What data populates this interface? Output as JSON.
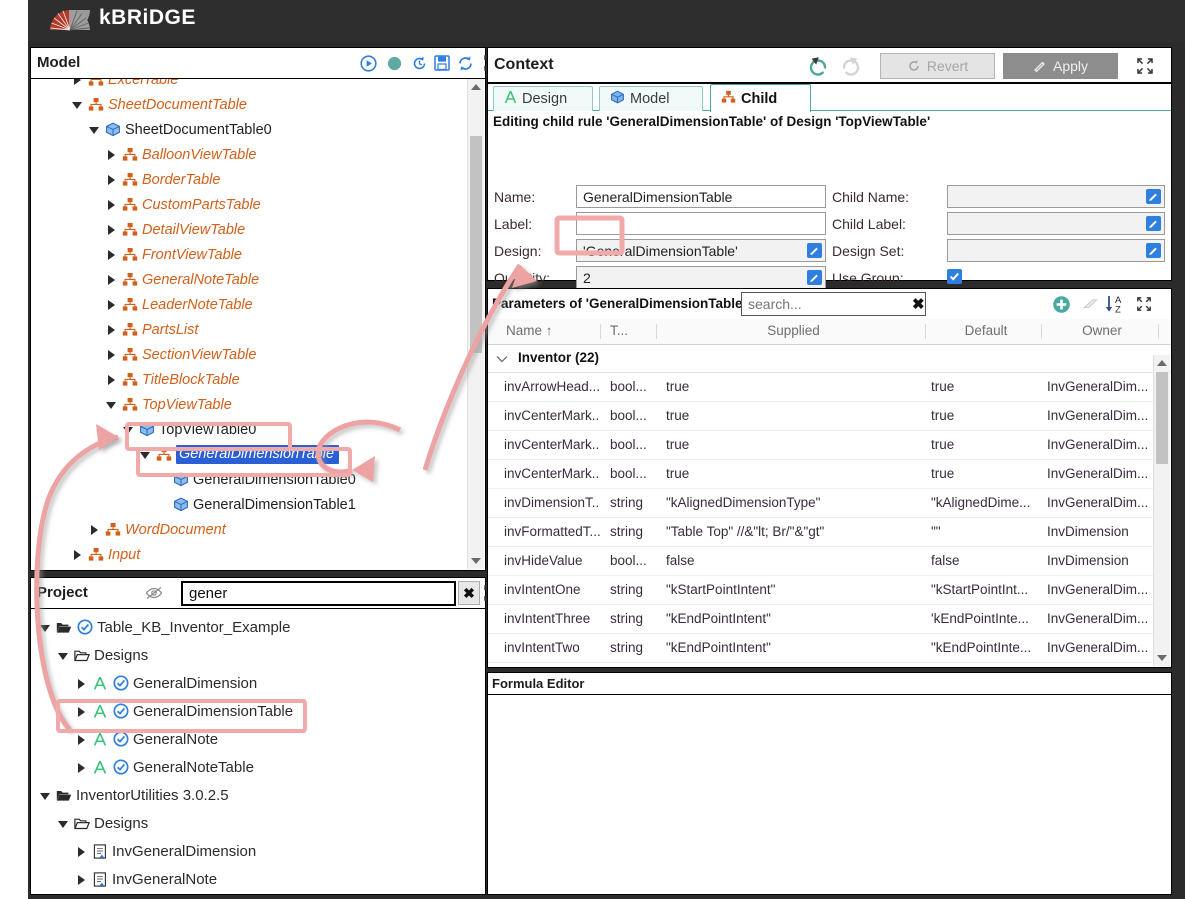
{
  "titlebar": {
    "product": "kBRiDGE",
    "logo_icon": "kbridge-logo-icon"
  },
  "model_panel": {
    "title": "Model",
    "toolbar": [
      {
        "name": "run-icon",
        "glyph": "▶"
      },
      {
        "name": "status-dot-icon",
        "glyph": "●"
      },
      {
        "name": "history-icon",
        "glyph": "↺"
      },
      {
        "name": "save-icon",
        "glyph": "💾"
      },
      {
        "name": "refresh-icon",
        "glyph": "⟳"
      },
      {
        "name": "maximize-icon",
        "glyph": "⤢"
      }
    ],
    "tree": [
      {
        "label": "ExcelTable",
        "depth": 2,
        "twist": "right",
        "icon": "design-icon",
        "kind": "design",
        "clipped": true
      },
      {
        "label": "SheetDocumentTable",
        "depth": 2,
        "twist": "down",
        "icon": "design-icon",
        "kind": "design"
      },
      {
        "label": "SheetDocumentTable0",
        "depth": 3,
        "twist": "down",
        "icon": "instance-icon",
        "kind": "instance"
      },
      {
        "label": "BalloonViewTable",
        "depth": 4,
        "twist": "right",
        "icon": "design-icon",
        "kind": "design"
      },
      {
        "label": "BorderTable",
        "depth": 4,
        "twist": "right",
        "icon": "design-icon",
        "kind": "design"
      },
      {
        "label": "CustomPartsTable",
        "depth": 4,
        "twist": "right",
        "icon": "design-icon",
        "kind": "design"
      },
      {
        "label": "DetailViewTable",
        "depth": 4,
        "twist": "right",
        "icon": "design-icon",
        "kind": "design"
      },
      {
        "label": "FrontViewTable",
        "depth": 4,
        "twist": "right",
        "icon": "design-icon",
        "kind": "design"
      },
      {
        "label": "GeneralNoteTable",
        "depth": 4,
        "twist": "right",
        "icon": "design-icon",
        "kind": "design"
      },
      {
        "label": "LeaderNoteTable",
        "depth": 4,
        "twist": "right",
        "icon": "design-icon",
        "kind": "design"
      },
      {
        "label": "PartsList",
        "depth": 4,
        "twist": "right",
        "icon": "design-icon",
        "kind": "design"
      },
      {
        "label": "SectionViewTable",
        "depth": 4,
        "twist": "right",
        "icon": "design-icon",
        "kind": "design"
      },
      {
        "label": "TitleBlockTable",
        "depth": 4,
        "twist": "right",
        "icon": "design-icon",
        "kind": "design"
      },
      {
        "label": "TopViewTable",
        "depth": 4,
        "twist": "down",
        "icon": "design-icon",
        "kind": "design"
      },
      {
        "label": "TopViewTable0",
        "depth": 5,
        "twist": "down",
        "icon": "instance-icon",
        "kind": "instance",
        "highlight": true
      },
      {
        "label": "GeneralDimensionTable",
        "depth": 6,
        "twist": "down",
        "icon": "design-icon",
        "kind": "design",
        "selected": true,
        "highlight": true
      },
      {
        "label": "GeneralDimensionTable0",
        "depth": 7,
        "twist": "none",
        "icon": "instance-icon",
        "kind": "instance"
      },
      {
        "label": "GeneralDimensionTable1",
        "depth": 7,
        "twist": "none",
        "icon": "instance-icon",
        "kind": "instance"
      },
      {
        "label": "WordDocument",
        "depth": 3,
        "twist": "right",
        "icon": "design-icon",
        "kind": "design"
      },
      {
        "label": "Input",
        "depth": 2,
        "twist": "right",
        "icon": "design-icon",
        "kind": "design",
        "clipped": true
      }
    ]
  },
  "project_panel": {
    "title": "Project",
    "filter_icon": "eye-slash-icon",
    "search_value": "gener",
    "clear_label": "✖",
    "maximize_icon": "maximize-icon",
    "tree": [
      {
        "label": "Table_KB_Inventor_Example",
        "depth": 0,
        "twist": "down",
        "icon": "folder-open-icon",
        "badge": "check-circle-icon"
      },
      {
        "label": "Designs",
        "depth": 1,
        "twist": "down",
        "icon": "folder-icon"
      },
      {
        "label": "GeneralDimension",
        "depth": 2,
        "twist": "right",
        "icon": "design-a-icon",
        "badge": "check-circle-icon"
      },
      {
        "label": "GeneralDimensionTable",
        "depth": 2,
        "twist": "right",
        "icon": "design-a-icon",
        "badge": "check-circle-icon",
        "highlight": true
      },
      {
        "label": "GeneralNote",
        "depth": 2,
        "twist": "right",
        "icon": "design-a-icon",
        "badge": "check-circle-icon"
      },
      {
        "label": "GeneralNoteTable",
        "depth": 2,
        "twist": "right",
        "icon": "design-a-icon",
        "badge": "check-circle-icon"
      },
      {
        "label": "InventorUtilities 3.0.2.5",
        "depth": 0,
        "twist": "down",
        "icon": "folder-open-icon"
      },
      {
        "label": "Designs",
        "depth": 1,
        "twist": "down",
        "icon": "folder-icon"
      },
      {
        "label": "InvGeneralDimension",
        "depth": 2,
        "twist": "right",
        "icon": "file-doc-icon"
      },
      {
        "label": "InvGeneralNote",
        "depth": 2,
        "twist": "right",
        "icon": "file-doc-icon"
      }
    ]
  },
  "context_panel": {
    "title": "Context",
    "undo_icon": "undo-icon",
    "redo_icon": "redo-icon",
    "revert_label": "Revert",
    "apply_label": "Apply",
    "maximize_icon": "maximize-icon",
    "tabs": [
      {
        "label": "Design",
        "icon": "design-a-icon",
        "active": false
      },
      {
        "label": "Model",
        "icon": "instance-icon",
        "active": false
      },
      {
        "label": "Child",
        "icon": "design-icon",
        "active": true
      }
    ],
    "editing_line": "Editing child rule 'GeneralDimensionTable' of Design 'TopViewTable'",
    "fields": {
      "name_label": "Name:",
      "name_value": "GeneralDimensionTable",
      "label_label": "Label:",
      "label_value": "",
      "design_label": "Design:",
      "design_value": "'GeneralDimensionTable'",
      "quantity_label": "Quantity:",
      "quantity_value": "2",
      "child_name_label": "Child Name:",
      "child_name_value": "",
      "child_label_label": "Child Label:",
      "child_label_value": "",
      "design_set_label": "Design Set:",
      "design_set_value": "",
      "use_group_label": "Use Group:",
      "use_group_checked": true,
      "doc_icon": "document-icon"
    }
  },
  "parameters_panel": {
    "title": "Parameters of 'GeneralDimensionTable'",
    "search_placeholder": "search...",
    "search_value": "",
    "clear_label": "✖",
    "toolbar": [
      {
        "name": "add-parameter-icon",
        "glyph": "+"
      },
      {
        "name": "erase-icon",
        "glyph": "▱"
      },
      {
        "name": "sort-az-icon",
        "glyph": "AZ"
      },
      {
        "name": "maximize-icon",
        "glyph": "⤢"
      }
    ],
    "columns": [
      "Name ↑",
      "T...",
      "Supplied",
      "Default",
      "Owner"
    ],
    "group": {
      "label": "Inventor (22)",
      "expanded": true
    },
    "rows": [
      {
        "name": "invArrowHead...",
        "type": "bool...",
        "supplied": "true",
        "default": "true",
        "owner": "InvGeneralDim..."
      },
      {
        "name": "invCenterMark...",
        "type": "bool...",
        "supplied": "true",
        "default": "true",
        "owner": "InvGeneralDim..."
      },
      {
        "name": "invCenterMark...",
        "type": "bool...",
        "supplied": "true",
        "default": "true",
        "owner": "InvGeneralDim..."
      },
      {
        "name": "invCenterMark...",
        "type": "bool...",
        "supplied": "true",
        "default": "true",
        "owner": "InvGeneralDim..."
      },
      {
        "name": "invDimensionT...",
        "type": "string",
        "supplied": "\"kAlignedDimensionType\"",
        "default": "\"kAlignedDime...",
        "owner": "InvGeneralDim..."
      },
      {
        "name": "invFormattedT...",
        "type": "string",
        "supplied": "\"Table Top\" //&\"lt; Br/\"&\"gt\"",
        "default": "\"\"",
        "owner": "InvDimension"
      },
      {
        "name": "invHideValue",
        "type": "bool...",
        "supplied": "false",
        "default": "false",
        "owner": "InvDimension"
      },
      {
        "name": "invIntentOne",
        "type": "string",
        "supplied": "\"kStartPointIntent\"",
        "default": "\"kStartPointInt...",
        "owner": "InvGeneralDim..."
      },
      {
        "name": "invIntentThree",
        "type": "string",
        "supplied": "\"kEndPointIntent\"",
        "default": "'kEndPointInte...",
        "owner": "InvGeneralDim..."
      },
      {
        "name": "invIntentTwo",
        "type": "string",
        "supplied": "\"kEndPointIntent\"",
        "default": "\"kEndPointInte...",
        "owner": "InvGeneralDim..."
      }
    ]
  },
  "formula_panel": {
    "title": "Formula Editor",
    "content": ""
  },
  "colors": {
    "accent_teal": "#4aa8a0",
    "design_orange": "#d2601a",
    "instance_blue": "#2f7fe0",
    "selection_blue": "#2a5fd6",
    "annotation_pink": "#f0aaaa",
    "titlebar_dark": "#2e2e2e"
  }
}
